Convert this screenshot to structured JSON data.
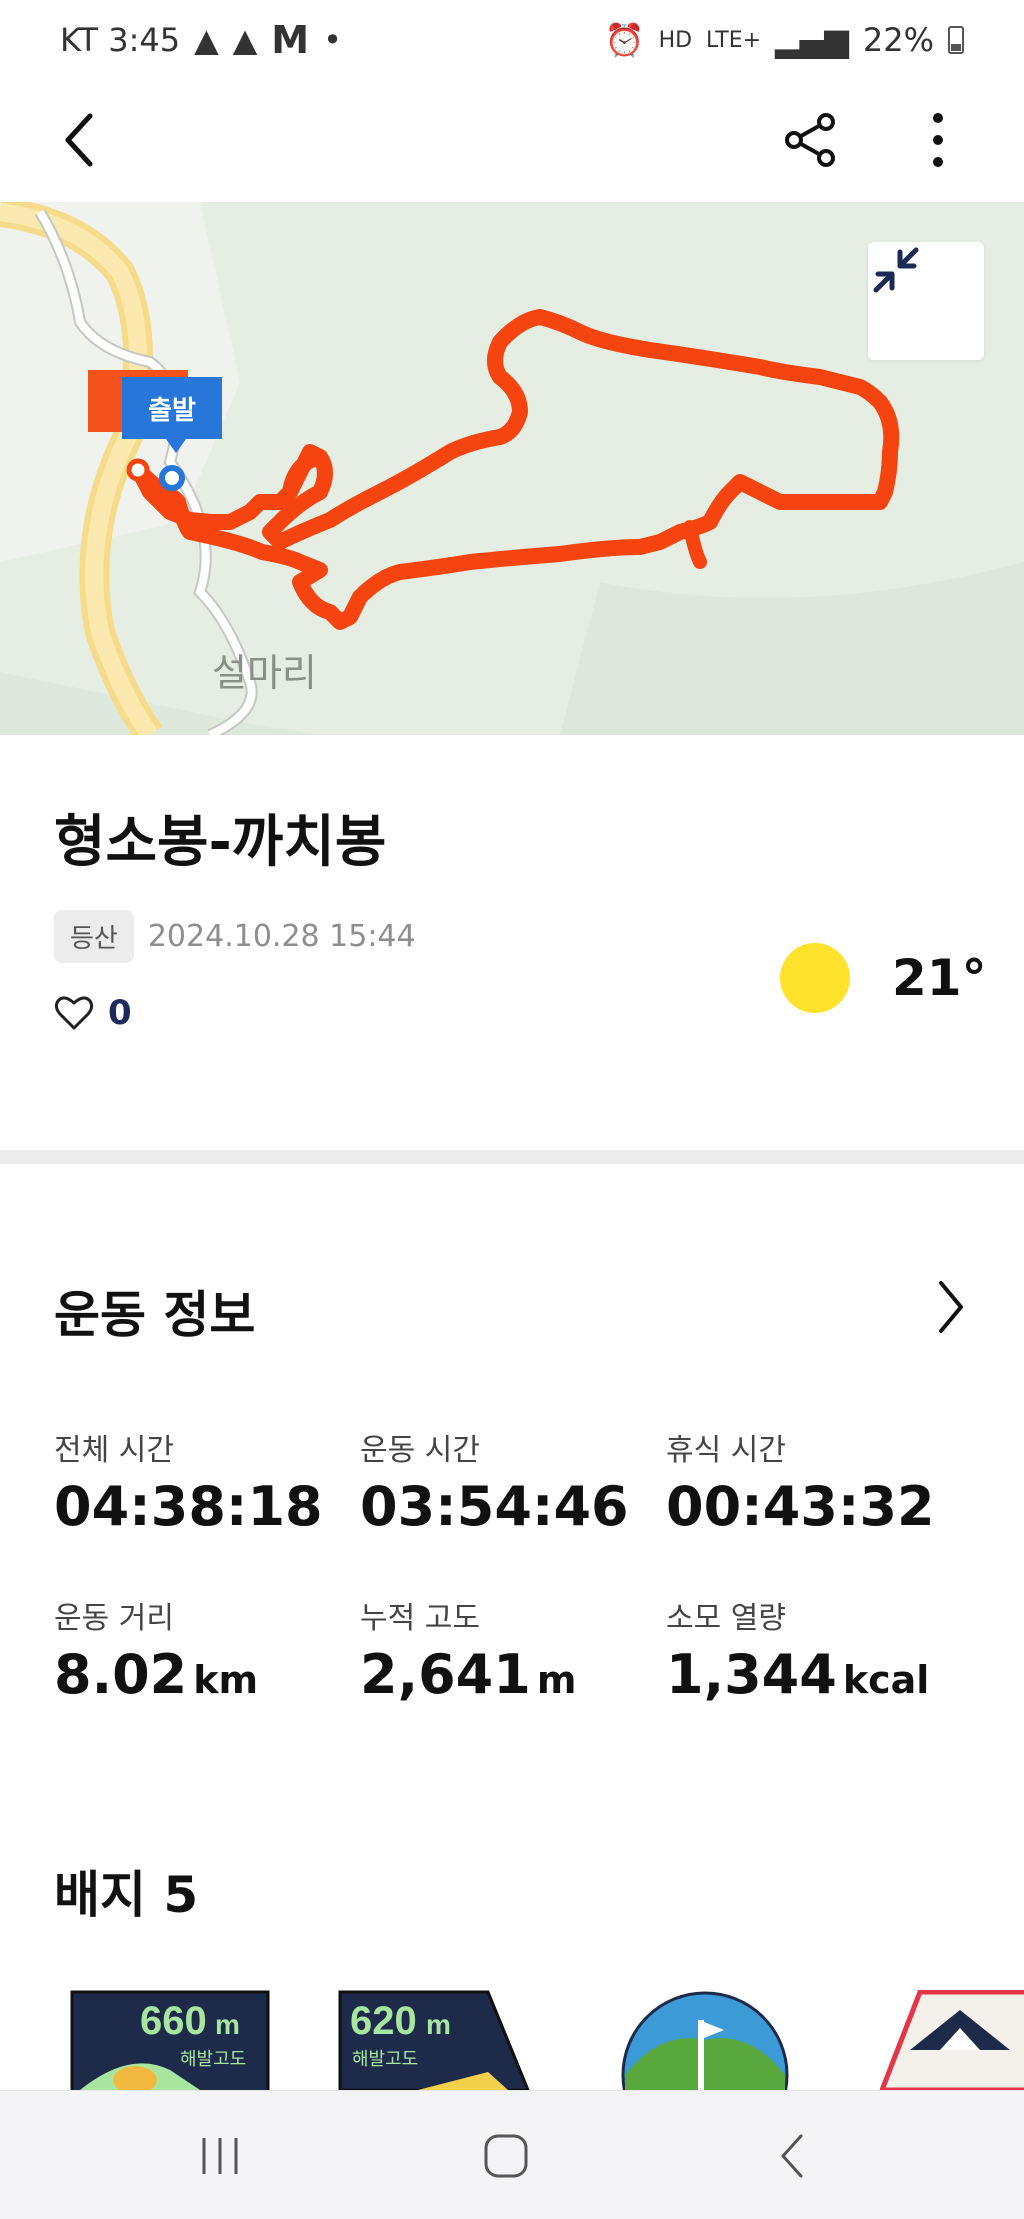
{
  "status_bar": {
    "carrier_time": "KT 3:45",
    "mail_indicator": "M",
    "hd_label": "HD",
    "network": "LTE+",
    "battery": "22%"
  },
  "header": {
    "back_icon": "chevron-left-icon",
    "share_icon": "share-icon",
    "more_icon": "more-vertical-icon"
  },
  "map": {
    "start_label": "출발",
    "place_label": "설마리",
    "route_color": "#f5440f",
    "expand_icon": "collapse-arrows-icon"
  },
  "activity": {
    "title": "형소봉-까치봉",
    "category": "등산",
    "datetime": "2024.10.28 15:44",
    "likes": "0",
    "temperature": "21°",
    "weather_icon": "sun-icon"
  },
  "exercise_info": {
    "heading": "운동 정보",
    "stats": [
      {
        "label": "전체 시간",
        "value": "04:38:18",
        "unit": ""
      },
      {
        "label": "운동 시간",
        "value": "03:54:46",
        "unit": ""
      },
      {
        "label": "휴식 시간",
        "value": "00:43:32",
        "unit": ""
      },
      {
        "label": "운동 거리",
        "value": "8.02",
        "unit": "km"
      },
      {
        "label": "누적 고도",
        "value": "2,641",
        "unit": "m"
      },
      {
        "label": "소모 열량",
        "value": "1,344",
        "unit": "kcal"
      }
    ]
  },
  "badges": {
    "heading": "배지 5",
    "items": [
      {
        "value": "660m",
        "caption": "해발고도"
      },
      {
        "value": "620m",
        "caption": "해발고도"
      }
    ]
  },
  "colors": {
    "accent_route": "#f5440f",
    "start_marker": "#2677d9",
    "sun": "#ffe22c",
    "badge_navy": "#1e2a4a"
  }
}
